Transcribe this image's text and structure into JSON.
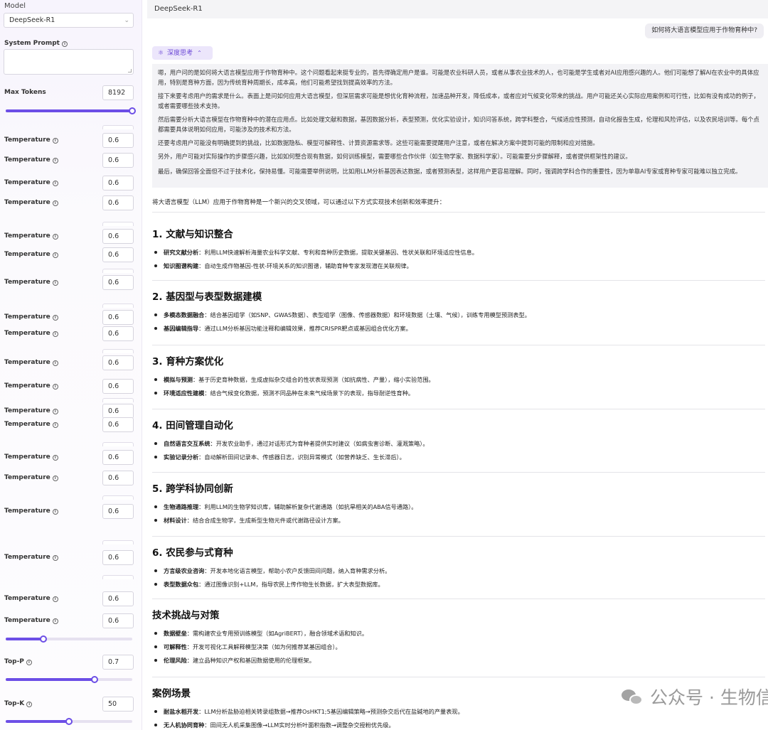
{
  "sidebar": {
    "model_label": "Model",
    "model_value": "DeepSeek-R1",
    "system_prompt_label": "System Prompt",
    "max_tokens_label": "Max Tokens",
    "max_tokens_value": "8192",
    "max_tokens_fraction": 1.0,
    "temperature_label": "Temperature",
    "temperature_value": "0.6",
    "temperature_fraction": 0.3,
    "top_p_label": "Top-P",
    "top_p_value": "0.7",
    "top_p_fraction": 0.7,
    "top_k_label": "Top-K",
    "top_k_value": "50",
    "top_k_fraction": 0.5
  },
  "chat": {
    "title": "DeepSeek-R1",
    "user_message": "如何将大语言模型应用于作物育种中?",
    "thinking_label": "深度思考",
    "thinking_paragraphs": [
      "嗯，用户问的是如何将大语言模型应用于作物育种中。这个问题看起来挺专业的，首先得确定用户是谁。可能是农业科研人员，或者从事农业技术的人，也可能是学生或者对AI应用感兴趣的人。他们可能想了解AI在农业中的具体应用，特别是育种方面，因为传统育种周期长，成本高，他们可能希望找到提高效率的方法。",
      "接下来要考虑用户的需求是什么。表面上是问如何应用大语言模型，但深层需求可能是想优化育种流程，加速品种开发，降低成本，或者应对气候变化带来的挑战。用户可能还关心实际应用案例和可行性，比如有没有成功的例子，或者需要哪些技术支持。",
      "然后需要分析大语言模型在作物育种中的潜在应用点。比如处理文献和数据，基因数据分析，表型预测，优化实验设计，知识问答系统，跨学科整合，气候适应性预测，自动化报告生成，伦理和风险评估，以及农民培训等。每个点都需要具体说明如何应用，可能涉及的技术和方法。",
      "还要考虑用户可能没有明确提到的挑战，比如数据隐私、模型可解释性、计算资源需求等。这些可能需要提醒用户注意，或者在解决方案中提到可能的限制和应对措施。",
      "另外，用户可能对实际操作的步骤感兴趣，比如如何整合现有数据，如何训练模型，需要哪些合作伙伴（如生物学家、数据科学家）。可能需要分步骤解释，或者提供框架性的建议。",
      "最后，确保回答全面但不过于技术化，保持易懂。可能需要举例说明，比如用LLM分析基因表达数据，或者预测表型，这样用户更容易理解。同时，强调跨学科合作的重要性，因为单靠AI专家或育种专家可能难以独立完成。"
    ],
    "intro": "将大语言模型（LLM）应用于作物育种是一个新兴的交叉领域，可以通过以下方式实现技术创新和效率提升：",
    "sections": [
      {
        "title": "1. 文献与知识整合",
        "items": [
          {
            "bold": "研究文献分析",
            "text": "：利用LLM快速解析海量农业科学文献、专利和育种历史数据，提取关键基因、性状关联和环境适应性信息。"
          },
          {
            "bold": "知识图谱构建",
            "text": "：自动生成作物基因-性状-环境关系的知识图谱，辅助育种专家发现潜在关联规律。"
          }
        ]
      },
      {
        "title": "2. 基因型与表型数据建模",
        "items": [
          {
            "bold": "多模态数据融合",
            "text": "：结合基因组学（如SNP、GWAS数据）、表型组学（图像、传感器数据）和环境数据（土壤、气候），训练专用模型预测表型。"
          },
          {
            "bold": "基因编辑指导",
            "text": "：通过LLM分析基因功能注释和编辑效果，推荐CRISPR靶点或基因组合优化方案。"
          }
        ]
      },
      {
        "title": "3. 育种方案优化",
        "items": [
          {
            "bold": "模拟与预测",
            "text": "：基于历史育种数据，生成虚拟杂交组合的性状表现预测（如抗病性、产量），缩小实验范围。"
          },
          {
            "bold": "环境适应性建模",
            "text": "：结合气候变化数据，预测不同品种在未来气候场景下的表现，指导耐逆性育种。"
          }
        ]
      },
      {
        "title": "4. 田间管理自动化",
        "items": [
          {
            "bold": "自然语言交互系统",
            "text": "：开发农业助手，通过对话形式为育种者提供实时建议（如病虫害诊断、灌溉策略）。"
          },
          {
            "bold": "实验记录分析",
            "text": "：自动解析田间记录本、传感器日志，识别异常模式（如营养缺乏、生长滞后）。"
          }
        ]
      },
      {
        "title": "5. 跨学科协同创新",
        "items": [
          {
            "bold": "生物通路推理",
            "text": "：利用LLM的生物学知识库，辅助解析复杂代谢通路（如抗旱相关的ABA信号通路）。"
          },
          {
            "bold": "材料设计",
            "text": "：结合合成生物学，生成新型生物元件或代谢路径设计方案。"
          }
        ]
      },
      {
        "title": "6. 农民参与式育种",
        "items": [
          {
            "bold": "方言级农业咨询",
            "text": "：开发本地化语言模型，帮助小农户反馈田间问题，纳入育种需求分析。"
          },
          {
            "bold": "表型数据众包",
            "text": "：通过图像识别+LLM，指导农民上传作物生长数据，扩大表型数据库。"
          }
        ]
      },
      {
        "title": "技术挑战与对策",
        "items": [
          {
            "bold": "数据壁垒",
            "text": "：需构建农业专用预训练模型（如AgriBERT），融合领域术语和知识。"
          },
          {
            "bold": "可解释性",
            "text": "：开发可视化工具解释模型决策（如为何推荐某基因组合）。"
          },
          {
            "bold": "伦理风险",
            "text": "：建立品种知识产权和基因数据使用的伦理框架。"
          }
        ]
      },
      {
        "title": "案例场景",
        "items": [
          {
            "bold": "耐盐水稻开发",
            "text": "：LLM分析盐胁迫相关转录组数据→推荐OsHKT1;5基因编辑策略→预测杂交后代在盐碱地的产量表现。"
          },
          {
            "bold": "无人机协同育种",
            "text": "：田间无人机采集图像→LLM实时分析叶面积指数→调整杂交授粉优先级。"
          }
        ]
      }
    ]
  },
  "watermark": "公众号 · 生物信息与育种",
  "colors": {
    "accent": "#6c4ee6",
    "think_bg": "#f3f3f6",
    "think_label": "#6b47d6"
  }
}
